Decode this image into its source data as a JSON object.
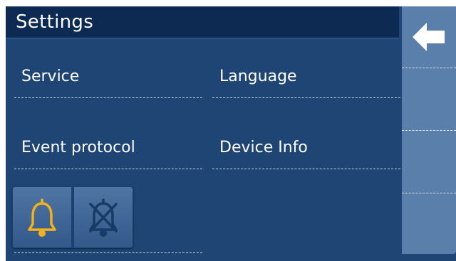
{
  "header": {
    "title": "Settings"
  },
  "menu": {
    "service": "Service",
    "language": "Language",
    "event_protocol": "Event protocol",
    "device_info": "Device Info"
  },
  "alarm_controls": {
    "enabled_icon": "bell-icon",
    "disabled_icon": "bell-crossed-icon",
    "enabled_color": "#f3b21b",
    "disabled_color": "#173a66"
  },
  "navigation": {
    "back_icon": "arrow-left-icon"
  },
  "colors": {
    "background": "#1f4574",
    "titlebar": "#0d2a52",
    "side_panel": "#5a7fab",
    "text": "#ffffff"
  }
}
